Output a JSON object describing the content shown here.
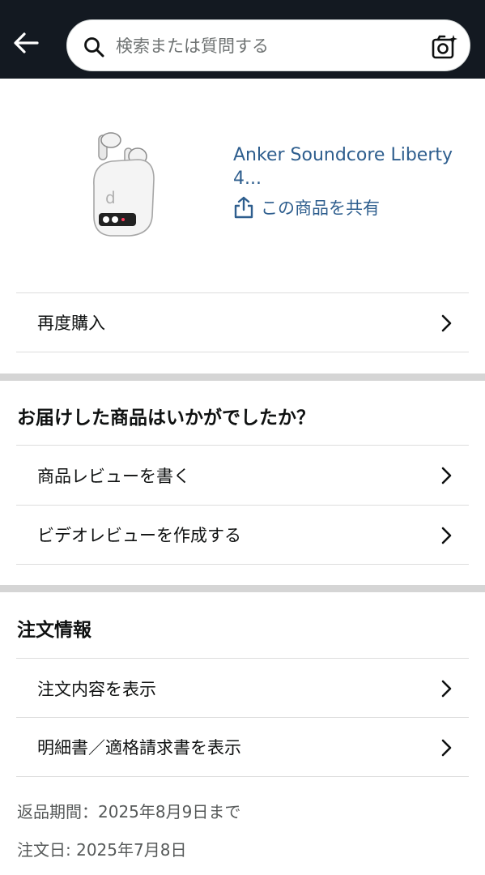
{
  "search": {
    "placeholder": "検索または質問する"
  },
  "product": {
    "title_line1": "Anker Soundcore Liberty",
    "title_line2": "4...",
    "share_label": "この商品を共有"
  },
  "actions": {
    "buy_again": "再度購入"
  },
  "feedback": {
    "title": "お届けした商品はいかがでしたか？",
    "write_review": "商品レビューを書く",
    "video_review": "ビデオレビューを作成する"
  },
  "order": {
    "title": "注文情報",
    "view_order": "注文内容を表示",
    "view_invoice": "明細書／適格請求書を表示",
    "return_period": "返品期間：2025年8月9日まで",
    "order_date": "注文日: 2025年7月8日"
  },
  "icons": {
    "back": "arrow-left-icon",
    "search": "search-icon",
    "camera": "camera-search-icon",
    "share": "share-icon",
    "chevron": "chevron-right-icon"
  },
  "colors": {
    "header_bg": "#131921",
    "link": "#2e5e8e",
    "divider": "#d5d5d5"
  }
}
